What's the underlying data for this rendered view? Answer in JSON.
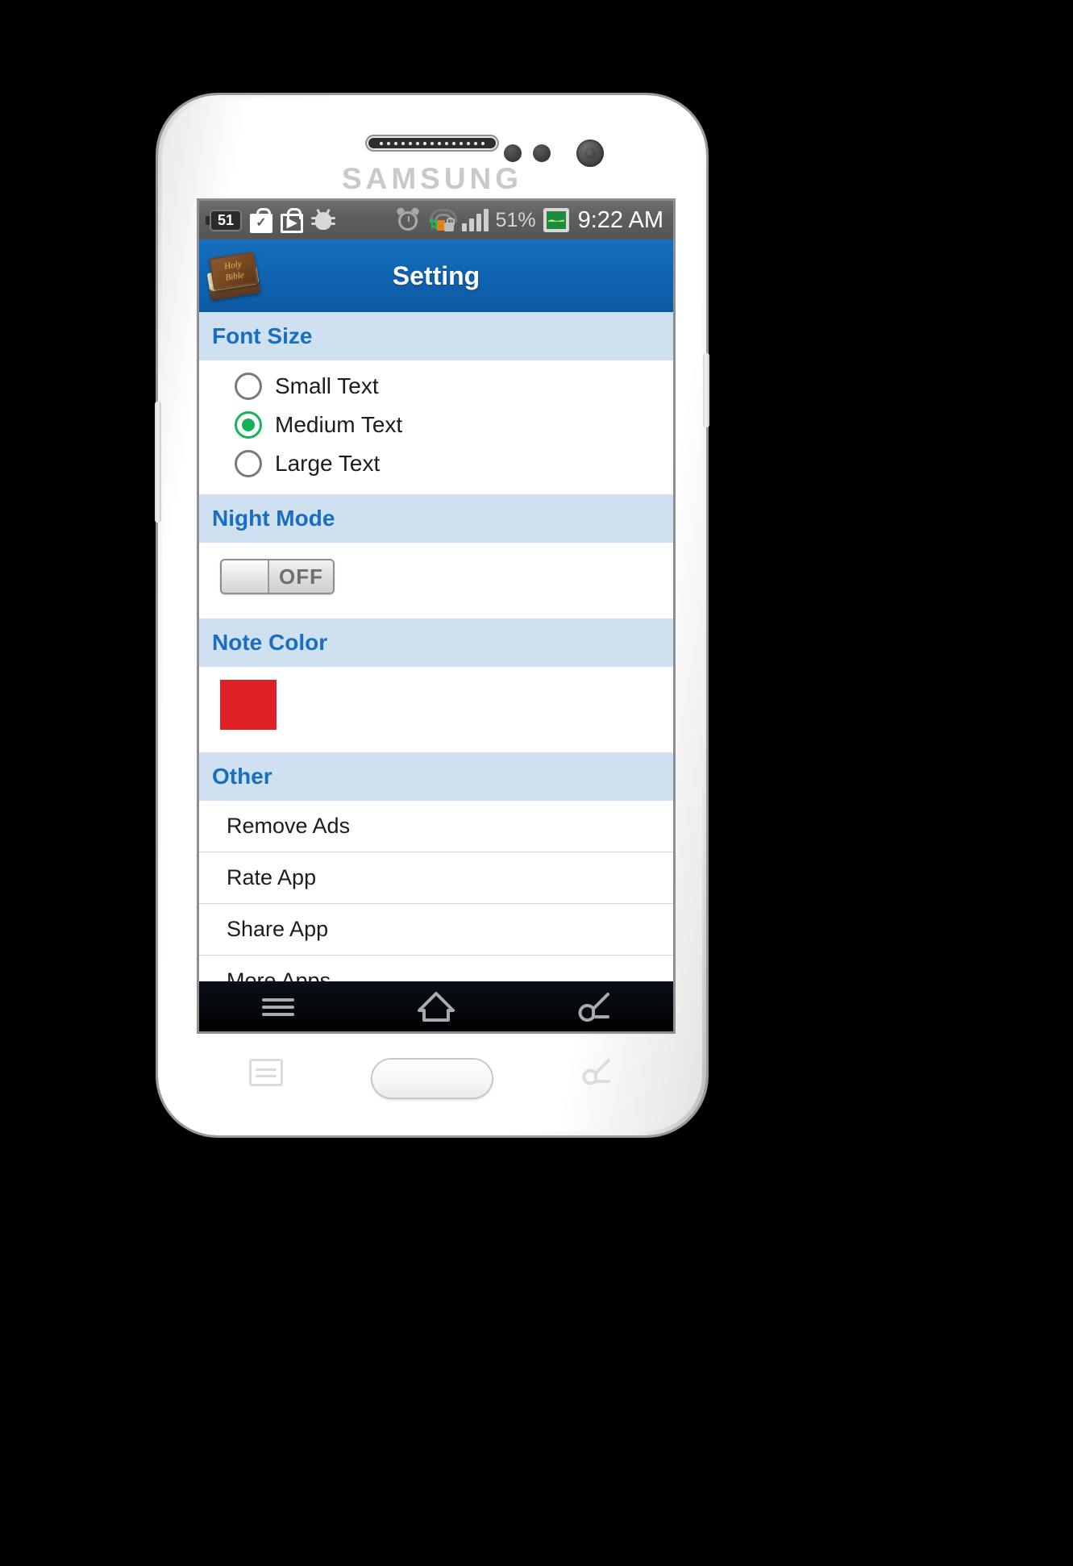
{
  "device": {
    "brand": "SAMSUNG",
    "speaker_icon": "speaker-grille",
    "camera_icon": "front-camera",
    "menu_key_icon": "menu-key-icon",
    "home_key_icon": "home-key-button",
    "back_key_icon": "back-key-icon"
  },
  "statusbar": {
    "left_icons": [
      {
        "name": "battery-saver-icon",
        "label": "51"
      },
      {
        "name": "play-store-update-icon",
        "label": ""
      },
      {
        "name": "play-store-icon",
        "label": ""
      },
      {
        "name": "debug-bug-icon",
        "label": ""
      }
    ],
    "right_icons": [
      {
        "name": "alarm-icon"
      },
      {
        "name": "sync-lock-icon"
      },
      {
        "name": "signal-bars-icon"
      }
    ],
    "battery_percent": "51%",
    "stocks_icon": "stocks-graph-icon",
    "clock": "9:22 AM"
  },
  "actionbar": {
    "app_icon": "holy-bible-book-icon",
    "app_icon_line1": "Holy",
    "app_icon_line2": "Bible",
    "title": "Setting"
  },
  "sections": [
    {
      "id": "font-size",
      "header": "Font Size",
      "type": "radio",
      "options": [
        {
          "label": "Small Text",
          "selected": false
        },
        {
          "label": "Medium Text",
          "selected": true
        },
        {
          "label": "Large Text",
          "selected": false
        }
      ]
    },
    {
      "id": "night-mode",
      "header": "Night Mode",
      "type": "toggle",
      "toggle_label": "OFF",
      "toggle_on": false
    },
    {
      "id": "note-color",
      "header": "Note Color",
      "type": "color",
      "color": "#de2127"
    },
    {
      "id": "other",
      "header": "Other",
      "type": "list",
      "items": [
        {
          "label": "Remove Ads"
        },
        {
          "label": "Rate App"
        },
        {
          "label": "Share App"
        },
        {
          "label": "More Apps"
        }
      ]
    }
  ],
  "navbar": {
    "menu_icon": "menu-icon",
    "home_icon": "home-icon",
    "back_icon": "back-icon"
  },
  "colors": {
    "actionbar_blue": "#0f63b0",
    "section_header_bg": "#cfe0f0",
    "section_header_text": "#1a6ec0",
    "note_color_swatch": "#de2127",
    "radio_selected": "#12b457"
  }
}
